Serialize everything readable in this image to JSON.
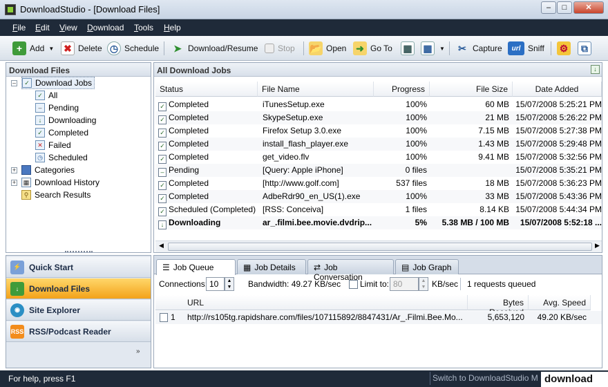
{
  "window": {
    "title": "DownloadStudio - [Download Files]"
  },
  "menu": [
    "File",
    "Edit",
    "View",
    "Download",
    "Tools",
    "Help"
  ],
  "toolbar": {
    "add": "Add",
    "delete": "Delete",
    "schedule": "Schedule",
    "download_resume": "Download/Resume",
    "stop": "Stop",
    "open": "Open",
    "go_to": "Go To",
    "capture": "Capture",
    "sniff": "Sniff"
  },
  "left_pane": {
    "header": "Download Files",
    "tree": {
      "download_jobs": "Download Jobs",
      "children": [
        "All",
        "Pending",
        "Downloading",
        "Completed",
        "Failed",
        "Scheduled"
      ],
      "categories": "Categories",
      "history": "Download History",
      "search": "Search Results"
    }
  },
  "nav": [
    "Quick Start",
    "Download Files",
    "Site Explorer",
    "RSS/Podcast Reader"
  ],
  "jobs": {
    "header": "All Download Jobs",
    "columns": [
      "Status",
      "File Name",
      "Progress",
      "File Size",
      "Date Added"
    ],
    "rows": [
      {
        "status": "Completed",
        "name": "iTunesSetup.exe",
        "progress": "100%",
        "size": "60 MB",
        "date": "15/07/2008 5:25:21 PM"
      },
      {
        "status": "Completed",
        "name": "SkypeSetup.exe",
        "progress": "100%",
        "size": "21 MB",
        "date": "15/07/2008 5:26:22 PM"
      },
      {
        "status": "Completed",
        "name": "Firefox Setup 3.0.exe",
        "progress": "100%",
        "size": "7.15 MB",
        "date": "15/07/2008 5:27:38 PM"
      },
      {
        "status": "Completed",
        "name": "install_flash_player.exe",
        "progress": "100%",
        "size": "1.43 MB",
        "date": "15/07/2008 5:29:48 PM"
      },
      {
        "status": "Completed",
        "name": "get_video.flv",
        "progress": "100%",
        "size": "9.41 MB",
        "date": "15/07/2008 5:32:56 PM"
      },
      {
        "status": "Pending",
        "name": "[Query: Apple iPhone]",
        "progress": "0 files",
        "size": "",
        "date": "15/07/2008 5:35:21 PM"
      },
      {
        "status": "Completed",
        "name": "[http://www.golf.com]",
        "progress": "537 files",
        "size": "18 MB",
        "date": "15/07/2008 5:36:23 PM"
      },
      {
        "status": "Completed",
        "name": "AdbeRdr90_en_US(1).exe",
        "progress": "100%",
        "size": "33 MB",
        "date": "15/07/2008 5:43:36 PM"
      },
      {
        "status": "Scheduled (Completed)",
        "name": "[RSS: Conceiva]",
        "progress": "1 files",
        "size": "8.14 KB",
        "date": "15/07/2008 5:44:34 PM"
      },
      {
        "status": "Downloading",
        "name": "ar_.filmi.bee.movie.dvdrip...",
        "progress": "5%",
        "size": "5.38 MB / 100 MB",
        "date": "15/07/2008 5:52:18 ..."
      }
    ]
  },
  "bottom": {
    "tabs": [
      "Job Queue",
      "Job Details",
      "Job Conversation",
      "Job Graph"
    ],
    "connections_label": "Connections:",
    "connections_value": "10",
    "bandwidth": "Bandwidth: 49.27 KB/sec",
    "limit_label": "Limit to:",
    "limit_value": "80",
    "limit_unit": "KB/sec",
    "queued": "1 requests queued",
    "columns": [
      "URL",
      "Bytes Received",
      "Avg. Speed"
    ],
    "rows": [
      {
        "index": "1",
        "url": "http://rs105tg.rapidshare.com/files/107115892/8847431/Ar_.Filmi.Bee.Mo...",
        "bytes": "5,653,120",
        "speed": "49.20 KB/sec"
      }
    ]
  },
  "status": {
    "help": "For help, press F1",
    "switch": "Switch to DownloadStudio M",
    "watermark": "download"
  }
}
